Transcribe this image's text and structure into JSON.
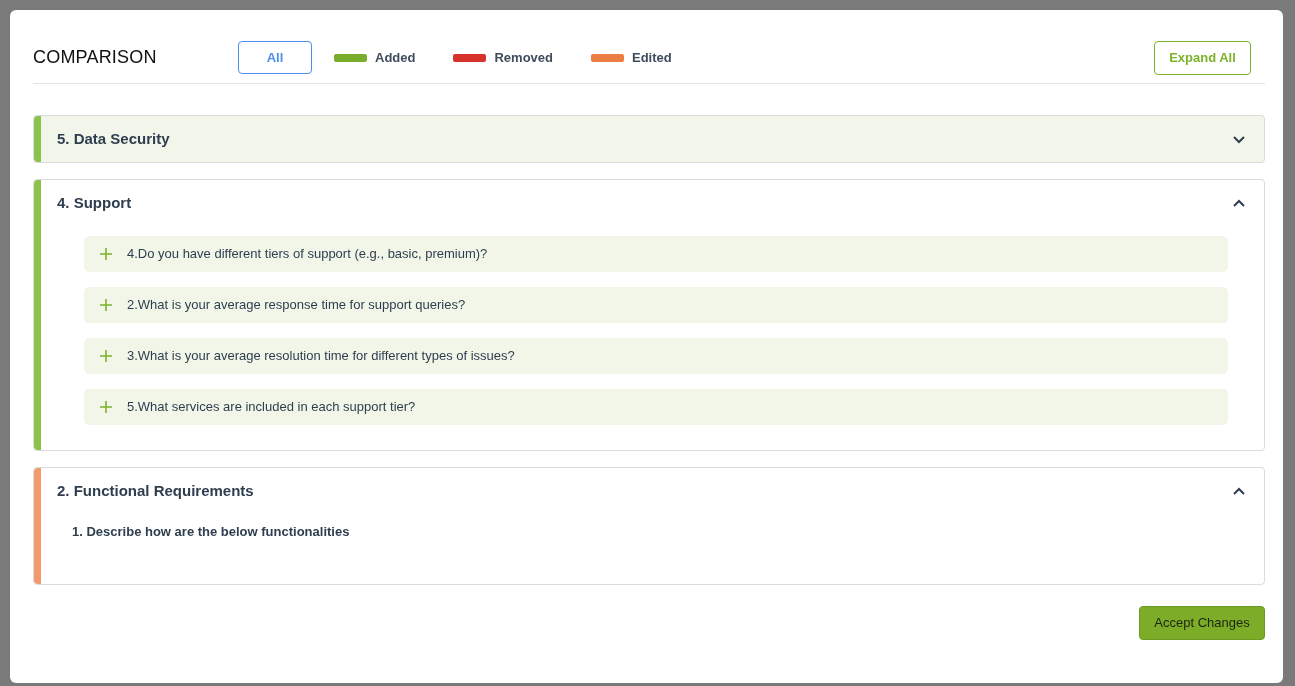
{
  "modal": {
    "title": "COMPARISON",
    "filters": [
      {
        "label": "All",
        "kind": "button",
        "selected": true
      },
      {
        "label": "Added",
        "kind": "legend",
        "color": "#7aad2c",
        "selected": false
      },
      {
        "label": "Removed",
        "kind": "legend",
        "color": "#d8322c",
        "selected": false
      },
      {
        "label": "Edited",
        "kind": "legend",
        "color": "#eb7f43",
        "selected": false
      }
    ],
    "expand_button": "Expand All",
    "sections": [
      {
        "title": "5. Data Security",
        "kind": "added",
        "color": "#8bc34a",
        "expanded": false
      },
      {
        "title": "4. Support",
        "kind": "added",
        "color": "#8bc34a",
        "expanded": true,
        "items": [
          {
            "kind": "added",
            "text": "4.Do you have different tiers of support (e.g., basic, premium)?"
          },
          {
            "kind": "added",
            "text": "2.What is your average response time for support queries?"
          },
          {
            "kind": "added",
            "text": "3.What is your average resolution time for different types of issues?"
          },
          {
            "kind": "added",
            "text": "5.What services are included in each support tier?"
          }
        ]
      },
      {
        "title": "2. Functional Requirements",
        "kind": "edited",
        "color": "#f29a6b",
        "expanded": true,
        "items": [
          {
            "kind": "plain",
            "text": "1. Describe how are the below functionalities"
          }
        ]
      }
    ],
    "accept_button": "Accept Changes"
  }
}
